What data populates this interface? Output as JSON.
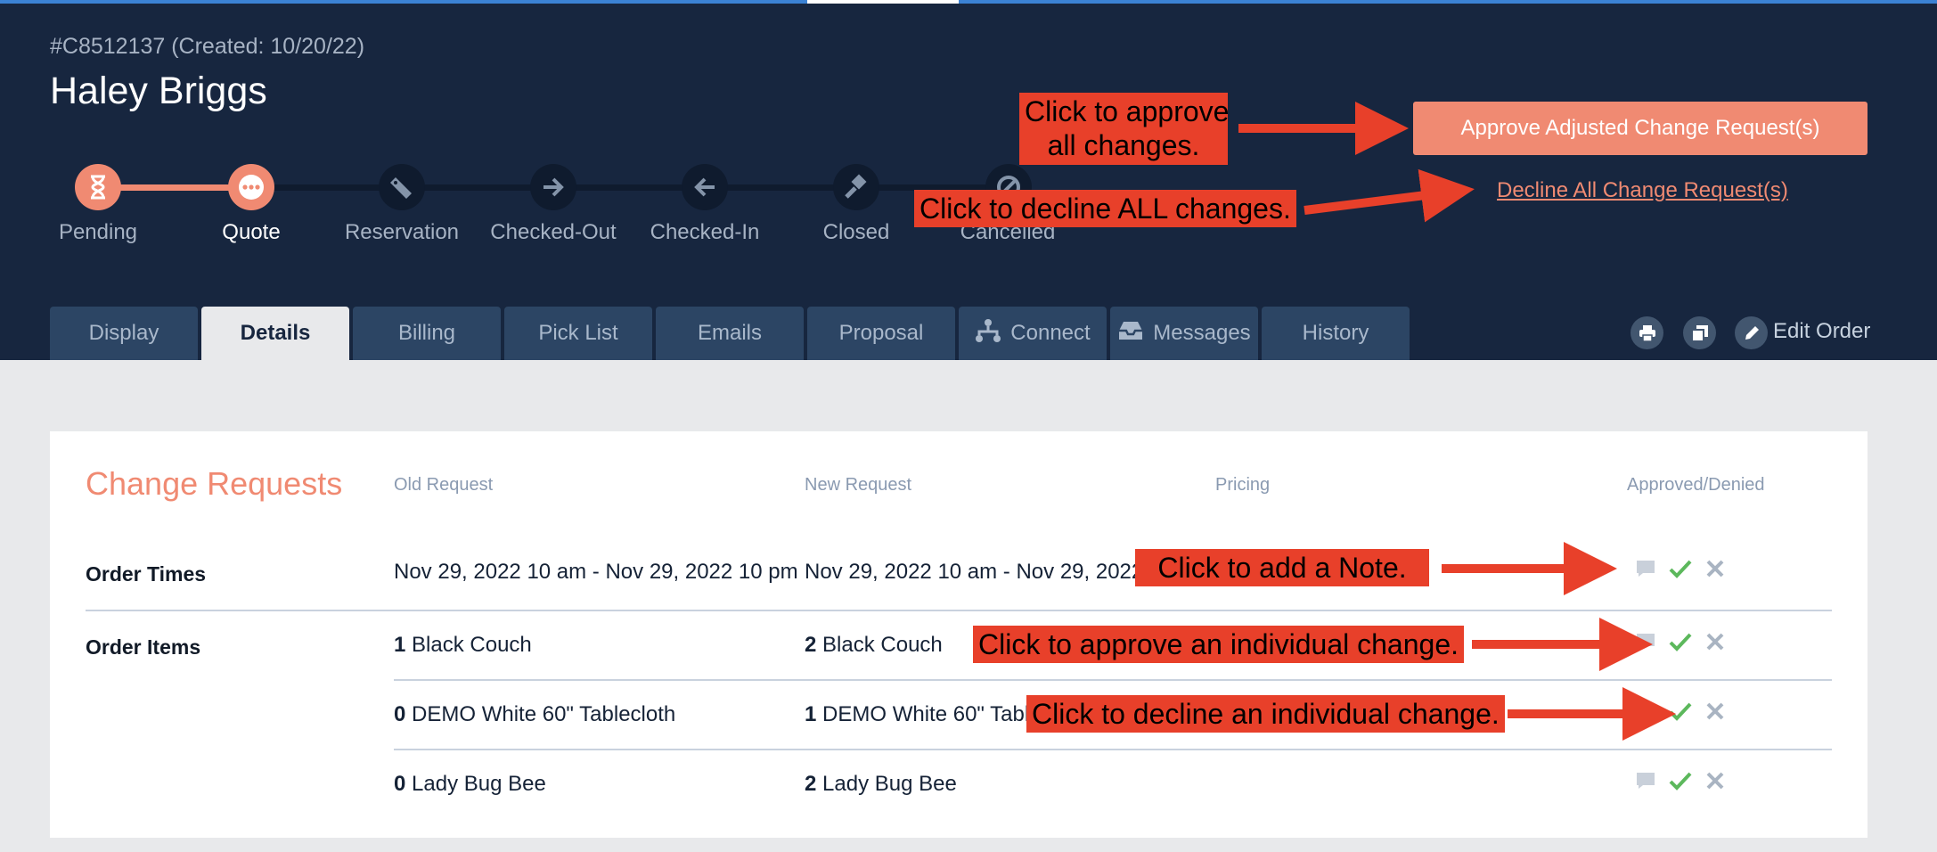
{
  "header": {
    "order_id": "#C8512137 (Created: 10/20/22)",
    "customer_name": "Haley Briggs"
  },
  "stages": [
    "Pending",
    "Quote",
    "Reservation",
    "Checked-Out",
    "Checked-In",
    "Closed",
    "Cancelled"
  ],
  "current_stage": "Quote",
  "actions": {
    "approve_all": "Approve Adjusted Change Request(s)",
    "decline_all": "Decline All Change Request(s)",
    "edit_order": "Edit Order"
  },
  "tabs": [
    "Display",
    "Details",
    "Billing",
    "Pick List",
    "Emails",
    "Proposal",
    "Connect",
    "Messages",
    "History"
  ],
  "active_tab": "Details",
  "change_requests": {
    "title": "Change Requests",
    "columns": [
      "Old Request",
      "New Request",
      "Pricing",
      "Approved/Denied"
    ],
    "order_times": {
      "label": "Order Times",
      "old": "Nov 29, 2022 10 am - Nov 29, 2022 10 pm",
      "new": "Nov 29, 2022 10 am - Nov 29, 2022"
    },
    "order_items": {
      "label": "Order Items",
      "rows": [
        {
          "old_qty": "1",
          "old_name": "Black Couch",
          "new_qty": "2",
          "new_name": "Black Couch"
        },
        {
          "old_qty": "0",
          "old_name": "DEMO White 60\" Tablecloth",
          "new_qty": "1",
          "new_name": "DEMO White 60\" Table"
        },
        {
          "old_qty": "0",
          "old_name": "Lady Bug Bee",
          "new_qty": "2",
          "new_name": "Lady Bug Bee"
        }
      ]
    }
  },
  "annotations": {
    "approve_all_line1": "Click to approve",
    "approve_all_line2": "all changes.",
    "decline_all": "Click to decline ALL changes.",
    "add_note": "Click to add a Note.",
    "approve_one": "Click to approve an individual change.",
    "decline_one": "Click to decline an individual change."
  },
  "colors": {
    "header_bg": "#17263f",
    "accent": "#f08a72",
    "tab_bg": "#2c4564",
    "approve_green": "#5cb85c",
    "callout_red": "#e8402a"
  },
  "icons": [
    "hourglass-icon",
    "ellipsis-icon",
    "ticket-icon",
    "arrow-right-icon",
    "arrow-left-icon",
    "gavel-icon",
    "ban-icon",
    "network-icon",
    "inbox-icon",
    "print-icon",
    "copy-icon",
    "pencil-icon",
    "comment-icon",
    "check-icon",
    "x-icon"
  ]
}
